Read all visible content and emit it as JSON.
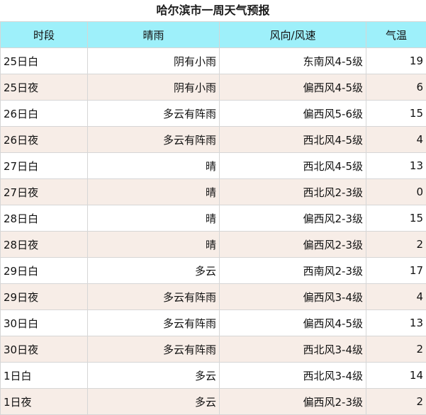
{
  "title": "哈尔滨市一周天气预报",
  "columns": {
    "period": "时段",
    "condition": "晴雨",
    "wind": "风向/风速",
    "temp": "气温"
  },
  "rows": [
    {
      "period": "25日白",
      "condition": "阴有小雨",
      "wind": "东南风4-5级",
      "temp": "19"
    },
    {
      "period": "25日夜",
      "condition": "阴有小雨",
      "wind": "偏西风4-5级",
      "temp": "6"
    },
    {
      "period": "26日白",
      "condition": "多云有阵雨",
      "wind": "偏西风5-6级",
      "temp": "15"
    },
    {
      "period": "26日夜",
      "condition": "多云有阵雨",
      "wind": "西北风4-5级",
      "temp": "4"
    },
    {
      "period": "27日白",
      "condition": "晴",
      "wind": "西北风4-5级",
      "temp": "13"
    },
    {
      "period": "27日夜",
      "condition": "晴",
      "wind": "西北风2-3级",
      "temp": "0"
    },
    {
      "period": "28日白",
      "condition": "晴",
      "wind": "偏西风2-3级",
      "temp": "15"
    },
    {
      "period": "28日夜",
      "condition": "晴",
      "wind": "偏西风2-3级",
      "temp": "2"
    },
    {
      "period": "29日白",
      "condition": "多云",
      "wind": "西南风2-3级",
      "temp": "17"
    },
    {
      "period": "29日夜",
      "condition": "多云有阵雨",
      "wind": "偏西风3-4级",
      "temp": "4"
    },
    {
      "period": "30日白",
      "condition": "多云有阵雨",
      "wind": "偏西风4-5级",
      "temp": "13"
    },
    {
      "period": "30日夜",
      "condition": "多云有阵雨",
      "wind": "西北风3-4级",
      "temp": "2"
    },
    {
      "period": "1日白",
      "condition": "多云",
      "wind": "西北风3-4级",
      "temp": "14"
    },
    {
      "period": "1日夜",
      "condition": "多云",
      "wind": "偏西风2-3级",
      "temp": "2"
    }
  ],
  "colors": {
    "header_bg": "#9ef0fa",
    "row_alt_bg": "#f7ede7",
    "row_bg": "#ffffff"
  }
}
